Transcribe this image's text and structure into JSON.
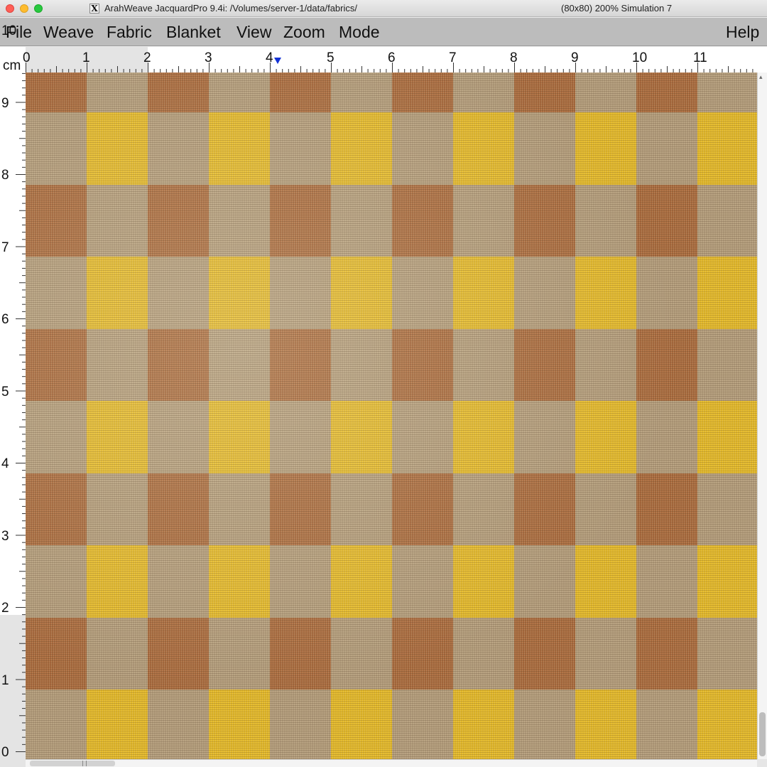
{
  "window": {
    "title_left": "ArahWeave JacquardPro 9.4i: /Volumes/server-1/data/fabrics/",
    "title_right": "(80x80) 200% Simulation 7",
    "x_icon_glyph": "X"
  },
  "menu": {
    "file": "File",
    "weave": "Weave",
    "fabric": "Fabric",
    "blanket": "Blanket",
    "view": "View",
    "zoom": "Zoom",
    "mode": "Mode",
    "help": "Help"
  },
  "ruler": {
    "unit": "cm",
    "top_labels": [
      "0",
      "1",
      "2",
      "3",
      "4",
      "5",
      "6",
      "7",
      "8",
      "9",
      "10",
      "11"
    ],
    "left_labels": [
      "10",
      "9",
      "8",
      "7",
      "6",
      "5",
      "4",
      "3",
      "2",
      "1",
      "0"
    ]
  },
  "fabric": {
    "colors": {
      "brown": "#a86a3e",
      "gray": "#b19b7b",
      "yellow": "#e2b82a"
    },
    "pattern": [
      [
        "brown",
        "gray",
        "brown",
        "gray",
        "brown",
        "gray",
        "brown",
        "gray",
        "brown",
        "gray",
        "brown",
        "gray"
      ],
      [
        "gray",
        "yellow",
        "gray",
        "yellow",
        "gray",
        "yellow",
        "gray",
        "yellow",
        "gray",
        "yellow",
        "gray",
        "yellow"
      ],
      [
        "brown",
        "gray",
        "brown",
        "gray",
        "brown",
        "gray",
        "brown",
        "gray",
        "brown",
        "gray",
        "brown",
        "gray"
      ],
      [
        "gray",
        "yellow",
        "gray",
        "yellow",
        "gray",
        "yellow",
        "gray",
        "yellow",
        "gray",
        "yellow",
        "gray",
        "yellow"
      ],
      [
        "brown",
        "gray",
        "brown",
        "gray",
        "brown",
        "gray",
        "brown",
        "gray",
        "brown",
        "gray",
        "brown",
        "gray"
      ],
      [
        "gray",
        "yellow",
        "gray",
        "yellow",
        "gray",
        "yellow",
        "gray",
        "yellow",
        "gray",
        "yellow",
        "gray",
        "yellow"
      ],
      [
        "brown",
        "gray",
        "brown",
        "gray",
        "brown",
        "gray",
        "brown",
        "gray",
        "brown",
        "gray",
        "brown",
        "gray"
      ],
      [
        "gray",
        "yellow",
        "gray",
        "yellow",
        "gray",
        "yellow",
        "gray",
        "yellow",
        "gray",
        "yellow",
        "gray",
        "yellow"
      ],
      [
        "brown",
        "gray",
        "brown",
        "gray",
        "brown",
        "gray",
        "brown",
        "gray",
        "brown",
        "gray",
        "brown",
        "gray"
      ],
      [
        "gray",
        "yellow",
        "gray",
        "yellow",
        "gray",
        "yellow",
        "gray",
        "yellow",
        "gray",
        "yellow",
        "gray",
        "yellow"
      ]
    ]
  }
}
